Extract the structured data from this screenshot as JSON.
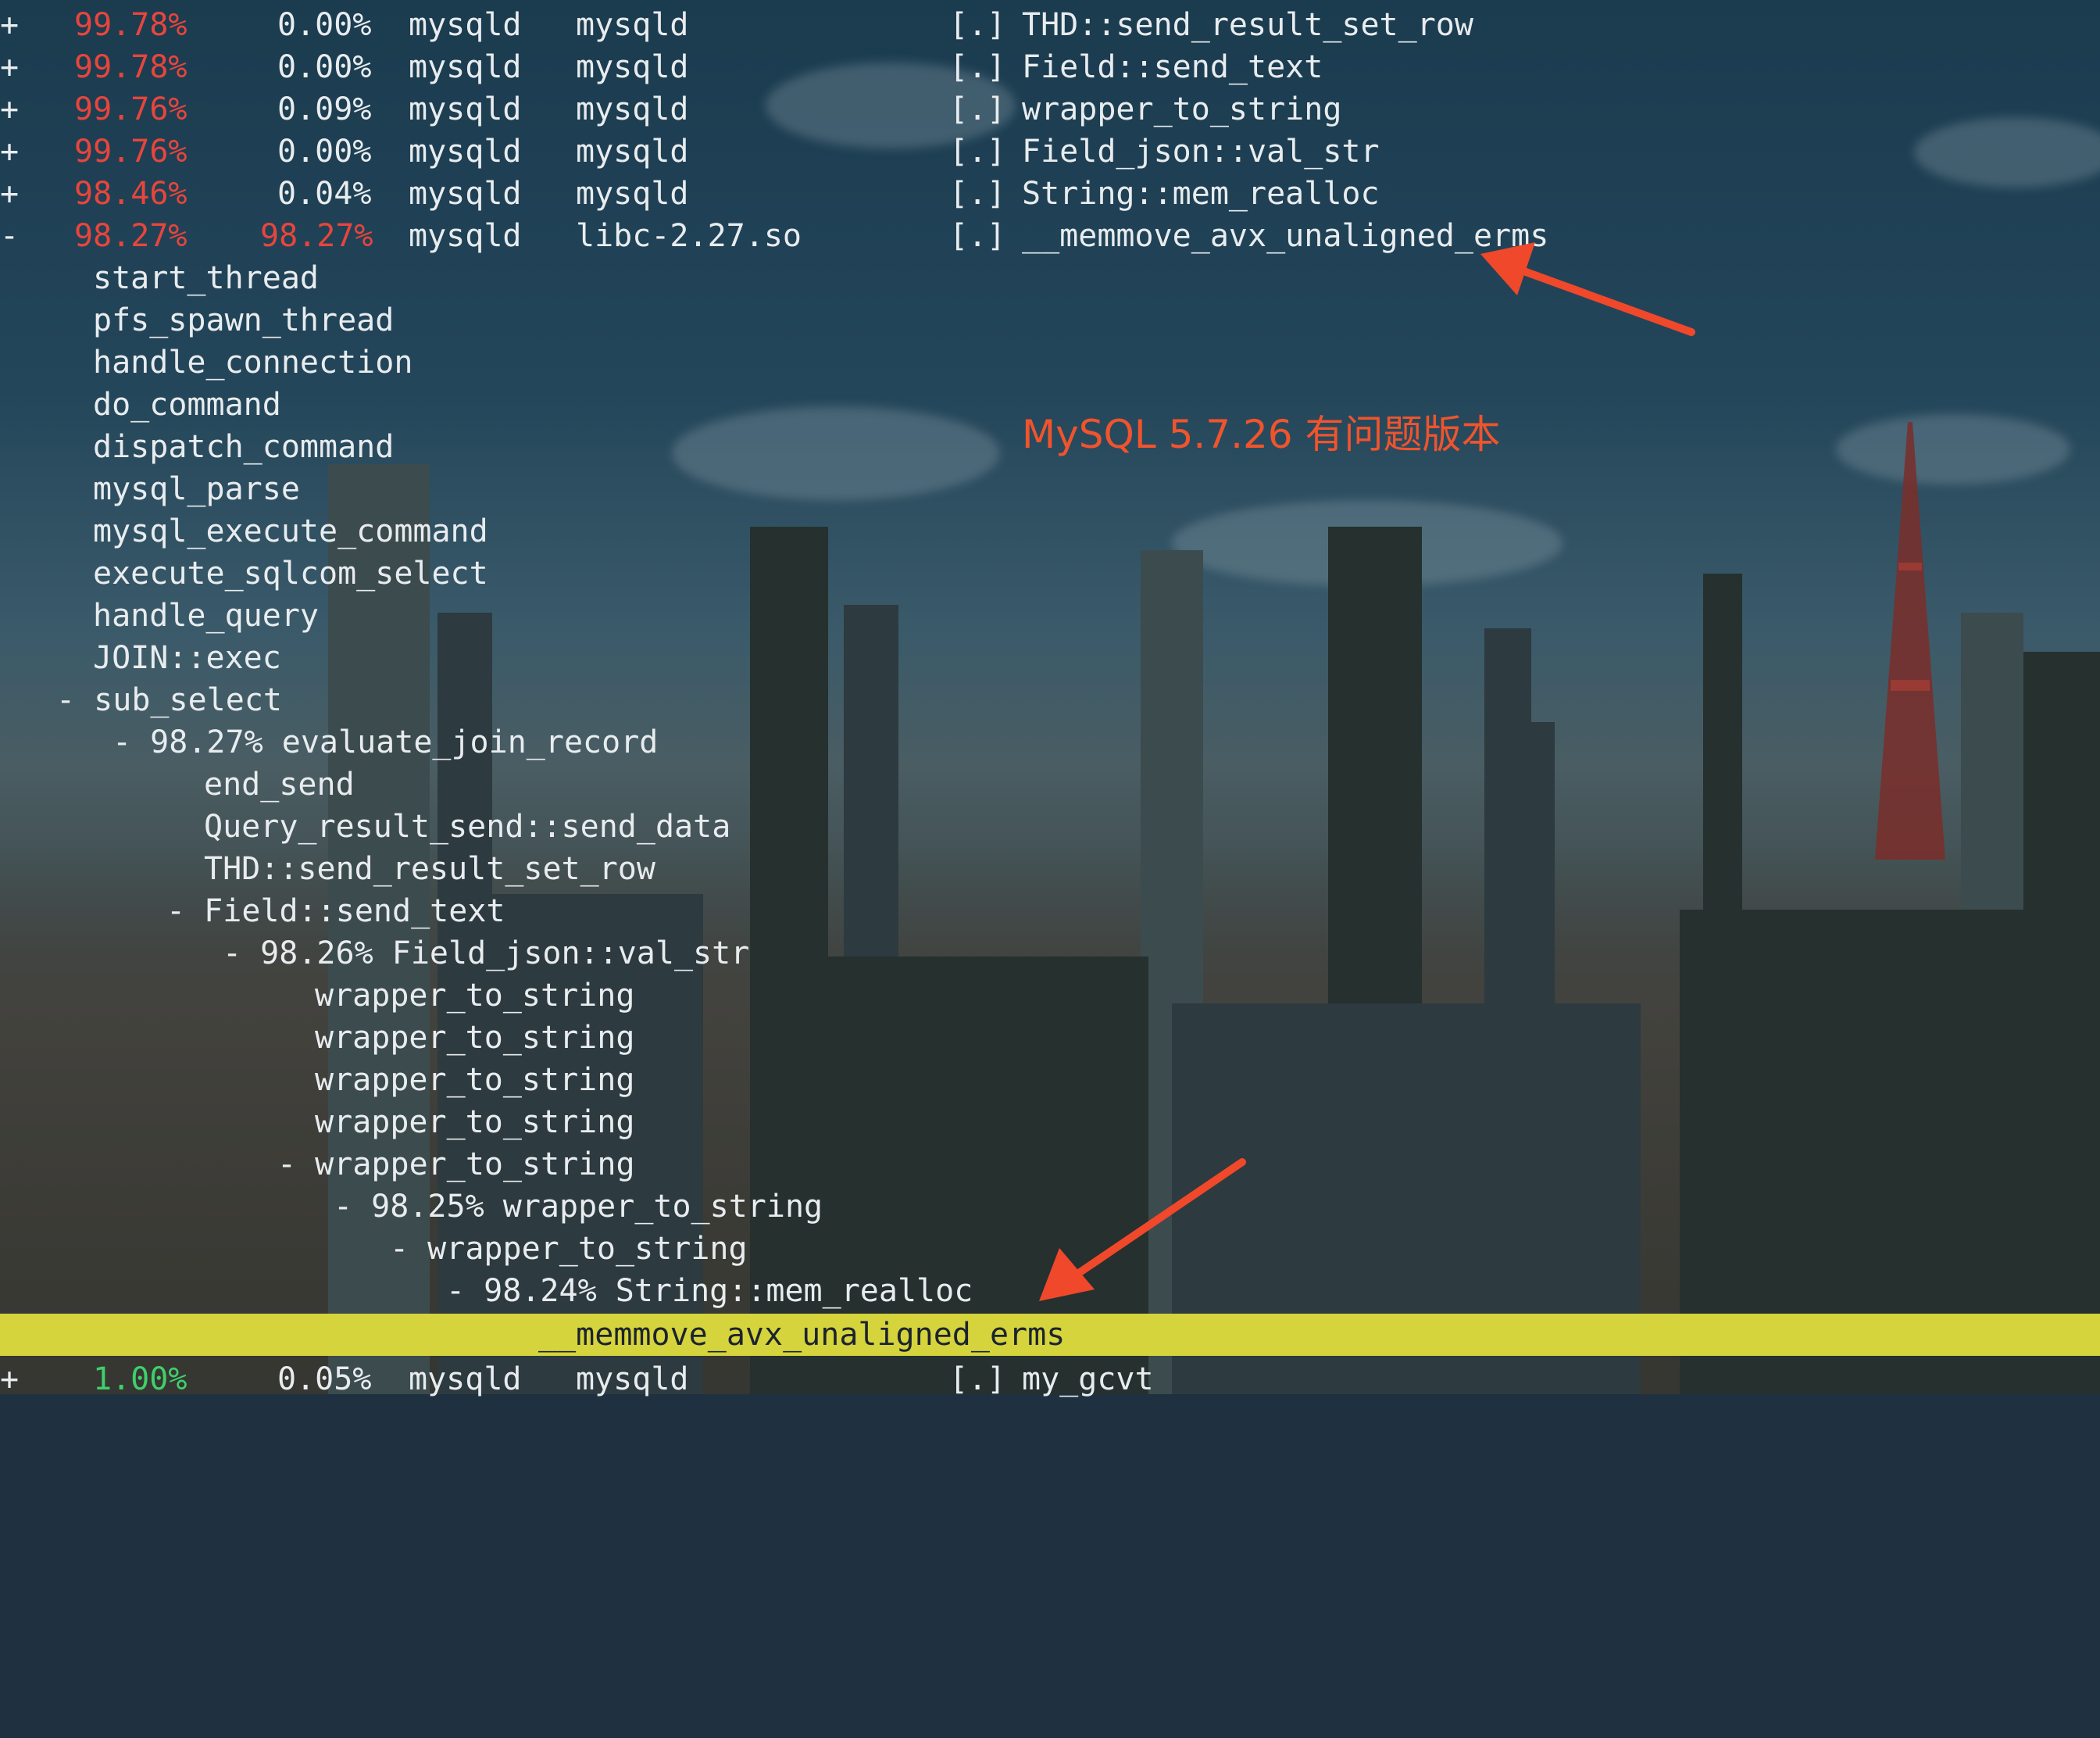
{
  "colors": {
    "default_text": "#e8ecee",
    "percent_high": "#e8453c",
    "percent_low": "#3fd06a",
    "highlight_bar": "#d5d43c",
    "annotation": "#f0542c"
  },
  "top_rows": [
    {
      "expander": "+",
      "children": "99.78%",
      "self": "0.00%",
      "command": "mysqld",
      "shared_object": "mysqld",
      "level": "[.]",
      "symbol": "THD::send_result_set_row"
    },
    {
      "expander": "+",
      "children": "99.78%",
      "self": "0.00%",
      "command": "mysqld",
      "shared_object": "mysqld",
      "level": "[.]",
      "symbol": "Field::send_text"
    },
    {
      "expander": "+",
      "children": "99.76%",
      "self": "0.09%",
      "command": "mysqld",
      "shared_object": "mysqld",
      "level": "[.]",
      "symbol": "wrapper_to_string"
    },
    {
      "expander": "+",
      "children": "99.76%",
      "self": "0.00%",
      "command": "mysqld",
      "shared_object": "mysqld",
      "level": "[.]",
      "symbol": "Field_json::val_str"
    },
    {
      "expander": "+",
      "children": "98.46%",
      "self": "0.04%",
      "command": "mysqld",
      "shared_object": "mysqld",
      "level": "[.]",
      "symbol": "String::mem_realloc"
    },
    {
      "expander": "-",
      "children": "98.27%",
      "self": "98.27%",
      "command": "mysqld",
      "shared_object": "libc-2.27.so",
      "level": "[.]",
      "symbol": "__memmove_avx_unaligned_erms"
    }
  ],
  "call_tree": [
    {
      "text": "start_thread"
    },
    {
      "text": "pfs_spawn_thread"
    },
    {
      "text": "handle_connection"
    },
    {
      "text": "do_command"
    },
    {
      "text": "dispatch_command"
    },
    {
      "text": "mysql_parse"
    },
    {
      "text": "mysql_execute_command"
    },
    {
      "text": "execute_sqlcom_select"
    },
    {
      "text": "handle_query"
    },
    {
      "text": "JOIN::exec"
    },
    {
      "text": "- sub_select"
    },
    {
      "text": "- 98.27% evaluate_join_record"
    },
    {
      "text": "end_send"
    },
    {
      "text": "Query_result_send::send_data"
    },
    {
      "text": "THD::send_result_set_row"
    },
    {
      "text": "- Field::send_text"
    },
    {
      "text": "- 98.26% Field_json::val_str"
    },
    {
      "text": "wrapper_to_string"
    },
    {
      "text": "wrapper_to_string"
    },
    {
      "text": "wrapper_to_string"
    },
    {
      "text": "wrapper_to_string"
    },
    {
      "text": "- wrapper_to_string"
    },
    {
      "text": "- 98.25% wrapper_to_string"
    },
    {
      "text": "- wrapper_to_string"
    },
    {
      "text": "- 98.24% String::mem_realloc"
    }
  ],
  "highlighted_row": {
    "text": "__memmove_avx_unaligned_erms"
  },
  "bottom_row": {
    "expander": "+",
    "children": "1.00%",
    "self": "0.05%",
    "command": "mysqld",
    "shared_object": "mysqld",
    "level": "[.]",
    "symbol": "my_gcvt"
  },
  "annotation": {
    "text": "MySQL 5.7.26 有问题版本"
  }
}
